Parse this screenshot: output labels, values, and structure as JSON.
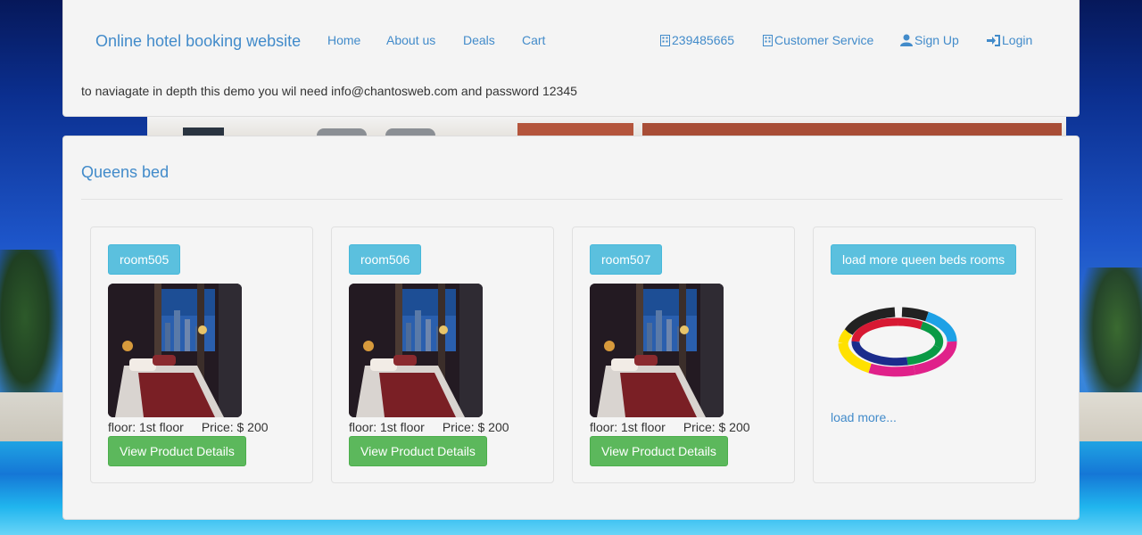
{
  "header": {
    "brand": "Online hotel booking website",
    "nav": {
      "home": "Home",
      "about": "About us",
      "deals": "Deals",
      "cart": "Cart"
    },
    "right_nav": {
      "phone": "239485665",
      "customer_service": "Customer Service",
      "sign_up": "Sign Up",
      "login": "Login"
    },
    "notice": "to naviagate in depth this demo you wil need info@chantosweb.com and password 12345"
  },
  "section": {
    "title": "Queens bed",
    "rooms": [
      {
        "name": "room505",
        "floor": "floor: 1st floor",
        "price": "Price: $ 200",
        "button": "View Product Details"
      },
      {
        "name": "room506",
        "floor": "floor: 1st floor",
        "price": "Price: $ 200",
        "button": "View Product Details"
      },
      {
        "name": "room507",
        "floor": "floor: 1st floor",
        "price": "Price: $ 200",
        "button": "View Product Details"
      }
    ],
    "load_more_card": {
      "button": "load more queen beds rooms",
      "link": "load more..."
    }
  },
  "colors": {
    "link": "#428bca",
    "info_button": "#5bc0de",
    "success_button": "#5cb85c",
    "panel": "#f4f4f4"
  },
  "icons": [
    "phone-icon",
    "headset-icon",
    "user-icon",
    "login-icon",
    "room-photo",
    "loading-spinner-icon"
  ]
}
